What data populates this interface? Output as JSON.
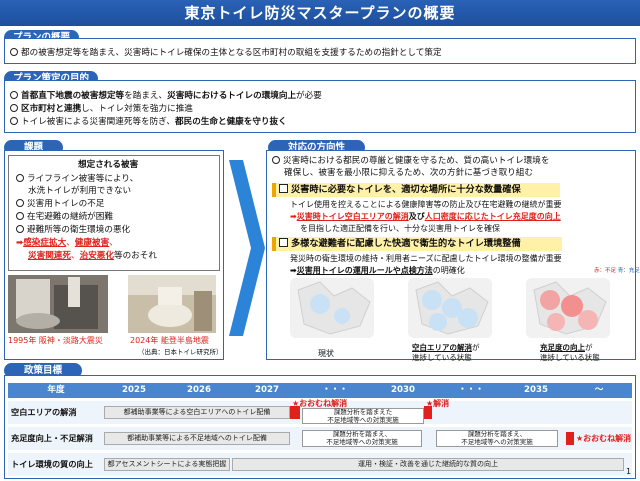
{
  "header": {
    "title": "東京トイレ防災マスタープランの概要"
  },
  "overview": {
    "tab": "プランの概要",
    "text": "都の被害想定等を踏まえ、災害時にトイレ確保の主体となる区市町村の取組を支援するための指針として策定"
  },
  "purpose": {
    "tab": "プラン策定の目的",
    "line1_a": "首都直下地震の被害想定等",
    "line1_b": "を踏まえ、",
    "line1_c": "災害時におけるトイレの環境向上",
    "line1_d": "が必要",
    "line2_a": "区市町村と連携",
    "line2_b": "し、トイレ対策を強力に推進",
    "line3_a": "トイレ被害による災害関連死等を防ぎ、",
    "line3_b": "都民の生命と健康を守り抜く"
  },
  "issues": {
    "tab": "課題",
    "heading": "想定される被害",
    "items": [
      "ライフライン被害等により、",
      "水洗トイレが利用できない",
      "災害用トイレの不足",
      "在宅避難の継続が困難",
      "避難所等の衛生環境の悪化"
    ],
    "result_a": "感染症拡大",
    "result_sep1": "、",
    "result_b": "健康被害",
    "result_sep2": "、",
    "result_c": "災害関連死",
    "result_sep3": "、",
    "result_d": "治安悪化",
    "result_e": "等のおそれ",
    "photo1_caption": "1995年 阪神・淡路大震災",
    "photo2_caption": "2024年 能登半島地震",
    "source": "（出典：日本トイレ研究所）"
  },
  "direction": {
    "tab": "対応の方向性",
    "intro1": "災害時における都民の尊厳と健康を守るため、質の高いトイレ環境を",
    "intro2": "確保し、被害を最小限に抑えるため、次の方針に基づき取り組む",
    "p1_title": "災害時に必要なトイレを、適切な場所に十分な数量確保",
    "p1_l1": "トイレ使用を控えることによる健康障害等の防止及び在宅避難の継続が重要",
    "p1_l2_a": "➡",
    "p1_l2_b": "災害時トイレ空白エリアの解消",
    "p1_l2_c": "及び",
    "p1_l2_d": "人口密度に応じたトイレ充足度の向上",
    "p1_l3": "を目指した適正配備を行い、十分な災害用トイレを確保",
    "p2_title": "多様な避難者に配慮した快適で衛生的なトイレ環境整備",
    "p2_l1": "発災時の衛生環境の維持・利用者ニーズに配慮したトイレ環境の整備が重要",
    "p2_l2_a": "➡",
    "p2_l2_b": "災害用トイレの運用ルールや点検方法",
    "p2_l2_c": "の明確化",
    "legend_a": "赤：不足",
    "legend_b": "青：充足",
    "map1_caption": "現状",
    "map2_caption_a": "空白エリアの解消",
    "map2_caption_b": "が",
    "map2_caption_c": "進捗している状態",
    "map3_caption_a": "充足度の向上",
    "map3_caption_b": "が",
    "map3_caption_c": "進捗している状態"
  },
  "goals": {
    "tab": "政策目標",
    "columns": [
      "年度",
      "2025",
      "2026",
      "2027",
      "・・・",
      "2030",
      "・・・",
      "2035",
      "～"
    ],
    "rows": [
      {
        "label": "空白エリアの解消",
        "bar": "都補助事業等による空白エリアへのトイレ配備",
        "star1": "★おおむね解消",
        "note": [
          "課題分析を踏まえた",
          "不足地域等への対策実施"
        ],
        "star2": "★解消"
      },
      {
        "label": "充足度向上・不足解消",
        "bar": "都補助事業等による不足地域へのトイレ配備",
        "note1": [
          "課題分析を踏まえ、",
          "不足地域等への対策実施"
        ],
        "note2": [
          "課題分析を踏まえ、",
          "不足地域等への対策実施"
        ],
        "star": "★おおむね解消"
      },
      {
        "label": "トイレ環境の質の向上",
        "bar1": "都アセスメントシートによる実態把握",
        "bar2": "運用・検証・改善を通じた継続的な質の向上"
      }
    ],
    "page_number": "1"
  }
}
